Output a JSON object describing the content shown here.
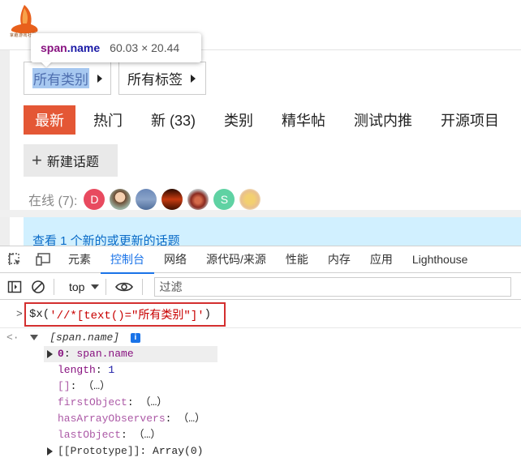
{
  "page": {
    "logo_text": "掌趣游戏社区",
    "tooltip": {
      "tag": "span",
      "selector": ".name",
      "dims": "60.03 × 20.44"
    },
    "category_dropdown": "所有类别",
    "tag_dropdown": "所有标签",
    "nav": [
      "最新",
      "热门",
      "新 (33)",
      "类别",
      "精华帖",
      "测试内推",
      "开源项目"
    ],
    "new_topic": "新建话题",
    "online_label": "在线 (7):",
    "avatars": [
      "D",
      "",
      "",
      "",
      "",
      "S",
      ""
    ],
    "banner_text": "查看 1 个新的或更新的话题"
  },
  "devtools": {
    "tabs": [
      "元素",
      "控制台",
      "网络",
      "源代码/来源",
      "性能",
      "内存",
      "应用",
      "Lighthouse"
    ],
    "active_tab": "控制台",
    "context": "top",
    "filter_placeholder": "过滤",
    "command_prefix": "$x(",
    "command_string": "'//*[text()=\"所有类别\"]'",
    "command_suffix": ")",
    "result_label": "[span.name]",
    "info": "i",
    "rows": [
      {
        "key": "0",
        "sep": ": ",
        "value": "span.name"
      },
      {
        "key": "length",
        "sep": ": ",
        "value": "1"
      },
      {
        "key": "[]",
        "sep": ": ",
        "value": "（…）"
      },
      {
        "key": "firstObject",
        "sep": ": ",
        "value": "（…）"
      },
      {
        "key": "hasArrayObservers",
        "sep": ": ",
        "value": "（…）"
      },
      {
        "key": "lastObject",
        "sep": ": ",
        "value": "（…）"
      },
      {
        "key": "[[Prototype]]",
        "sep": ": ",
        "value": "Array(0)"
      }
    ]
  },
  "colors": {
    "accent": "#e45735",
    "banner_bg": "#d1f0ff",
    "link": "#0a6bc7",
    "devtools_active": "#1a73e8",
    "highlight_box": "#d32f2f"
  },
  "icons": [
    "logo-icon",
    "caret-right-icon",
    "plus-icon",
    "inspect-icon",
    "device-icon",
    "sidebar-icon",
    "clear-icon",
    "eye-icon",
    "info-icon",
    "chevron-right-icon",
    "return-arrow-icon",
    "expand-icon",
    "collapse-icon"
  ]
}
